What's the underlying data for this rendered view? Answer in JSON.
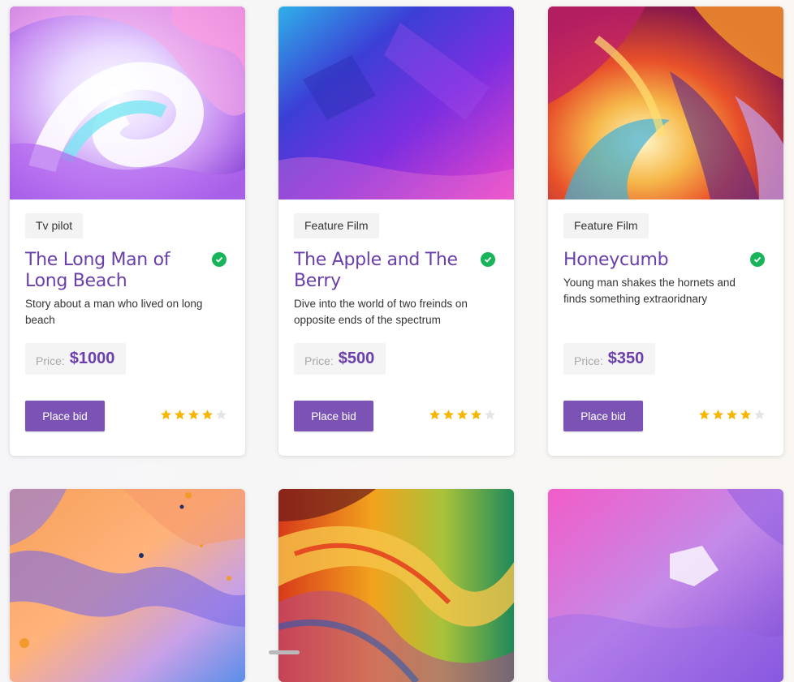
{
  "cards": [
    {
      "image": "swirling pastel 3D art",
      "tag": "Tv pilot",
      "title": "The Long Man of Long Beach",
      "description": "Story about a man who lived on long beach",
      "price_label": "Price:",
      "price": "$1000",
      "button": "Place bid",
      "rating": 4,
      "rating_max": 5,
      "verified_icon": "check-circle-icon"
    },
    {
      "image": "blue purple pink gradient canvas",
      "tag": "Feature Film",
      "title": "The Apple and The Berry",
      "description": "Dive into the world of two freinds on opposite ends of the spectrum",
      "price_label": "Price:",
      "price": "$500",
      "button": "Place bid",
      "rating": 4,
      "rating_max": 5,
      "verified_icon": "check-circle-icon"
    },
    {
      "image": "colorful paint splash",
      "tag": "Feature Film",
      "title": "Honeycumb",
      "description": "Young man shakes the hornets and finds something extraoridnary",
      "price_label": "Price:",
      "price": "$350",
      "button": "Place bid",
      "rating": 4,
      "rating_max": 5,
      "verified_icon": "check-circle-icon"
    },
    {
      "image": "fluid pastel marble"
    },
    {
      "image": "wavy rainbow lines"
    },
    {
      "image": "pink purple watercolor texture"
    }
  ],
  "colors": {
    "accent": "#6a3fab",
    "button": "#7b53b4",
    "star_on": "#f7b500",
    "star_off": "#e4e4e4",
    "verified": "#17b45a"
  }
}
